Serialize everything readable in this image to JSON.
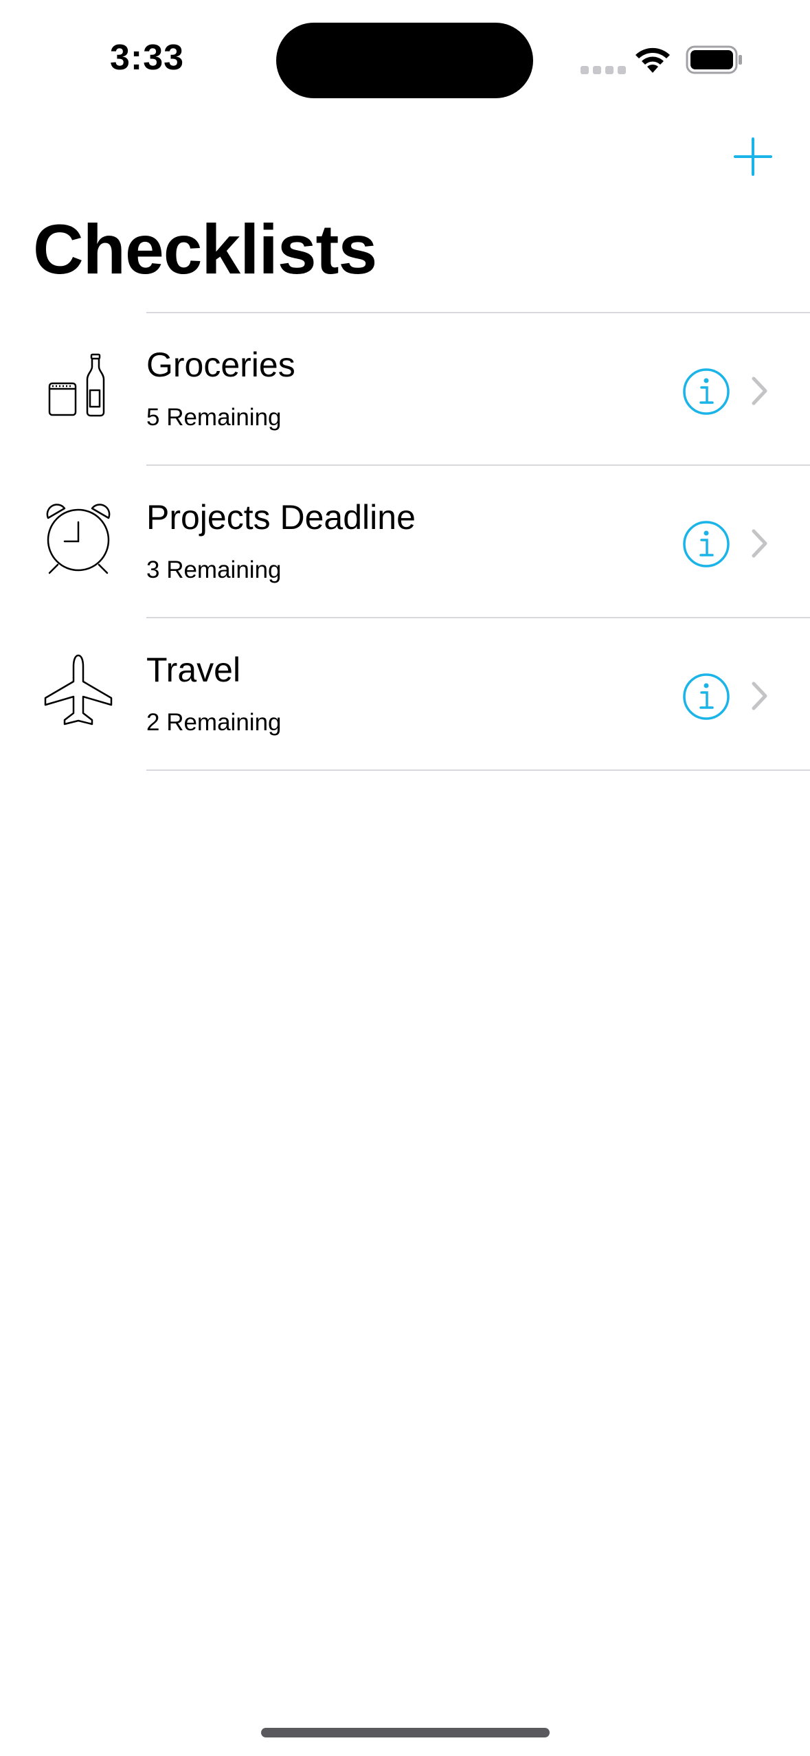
{
  "status_bar": {
    "time": "3:33"
  },
  "nav": {
    "add_icon": "plus-icon",
    "title": "Checklists"
  },
  "checklists": [
    {
      "title": "Groceries",
      "subtitle": "5 Remaining",
      "icon": "groceries-icon"
    },
    {
      "title": "Projects Deadline",
      "subtitle": "3 Remaining",
      "icon": "alarm-clock-icon"
    },
    {
      "title": "Travel",
      "subtitle": "2 Remaining",
      "icon": "airplane-icon"
    }
  ],
  "colors": {
    "accent": "#1ab4e8",
    "chevron": "#c4c4c7",
    "separator": "#d9d9dd"
  }
}
